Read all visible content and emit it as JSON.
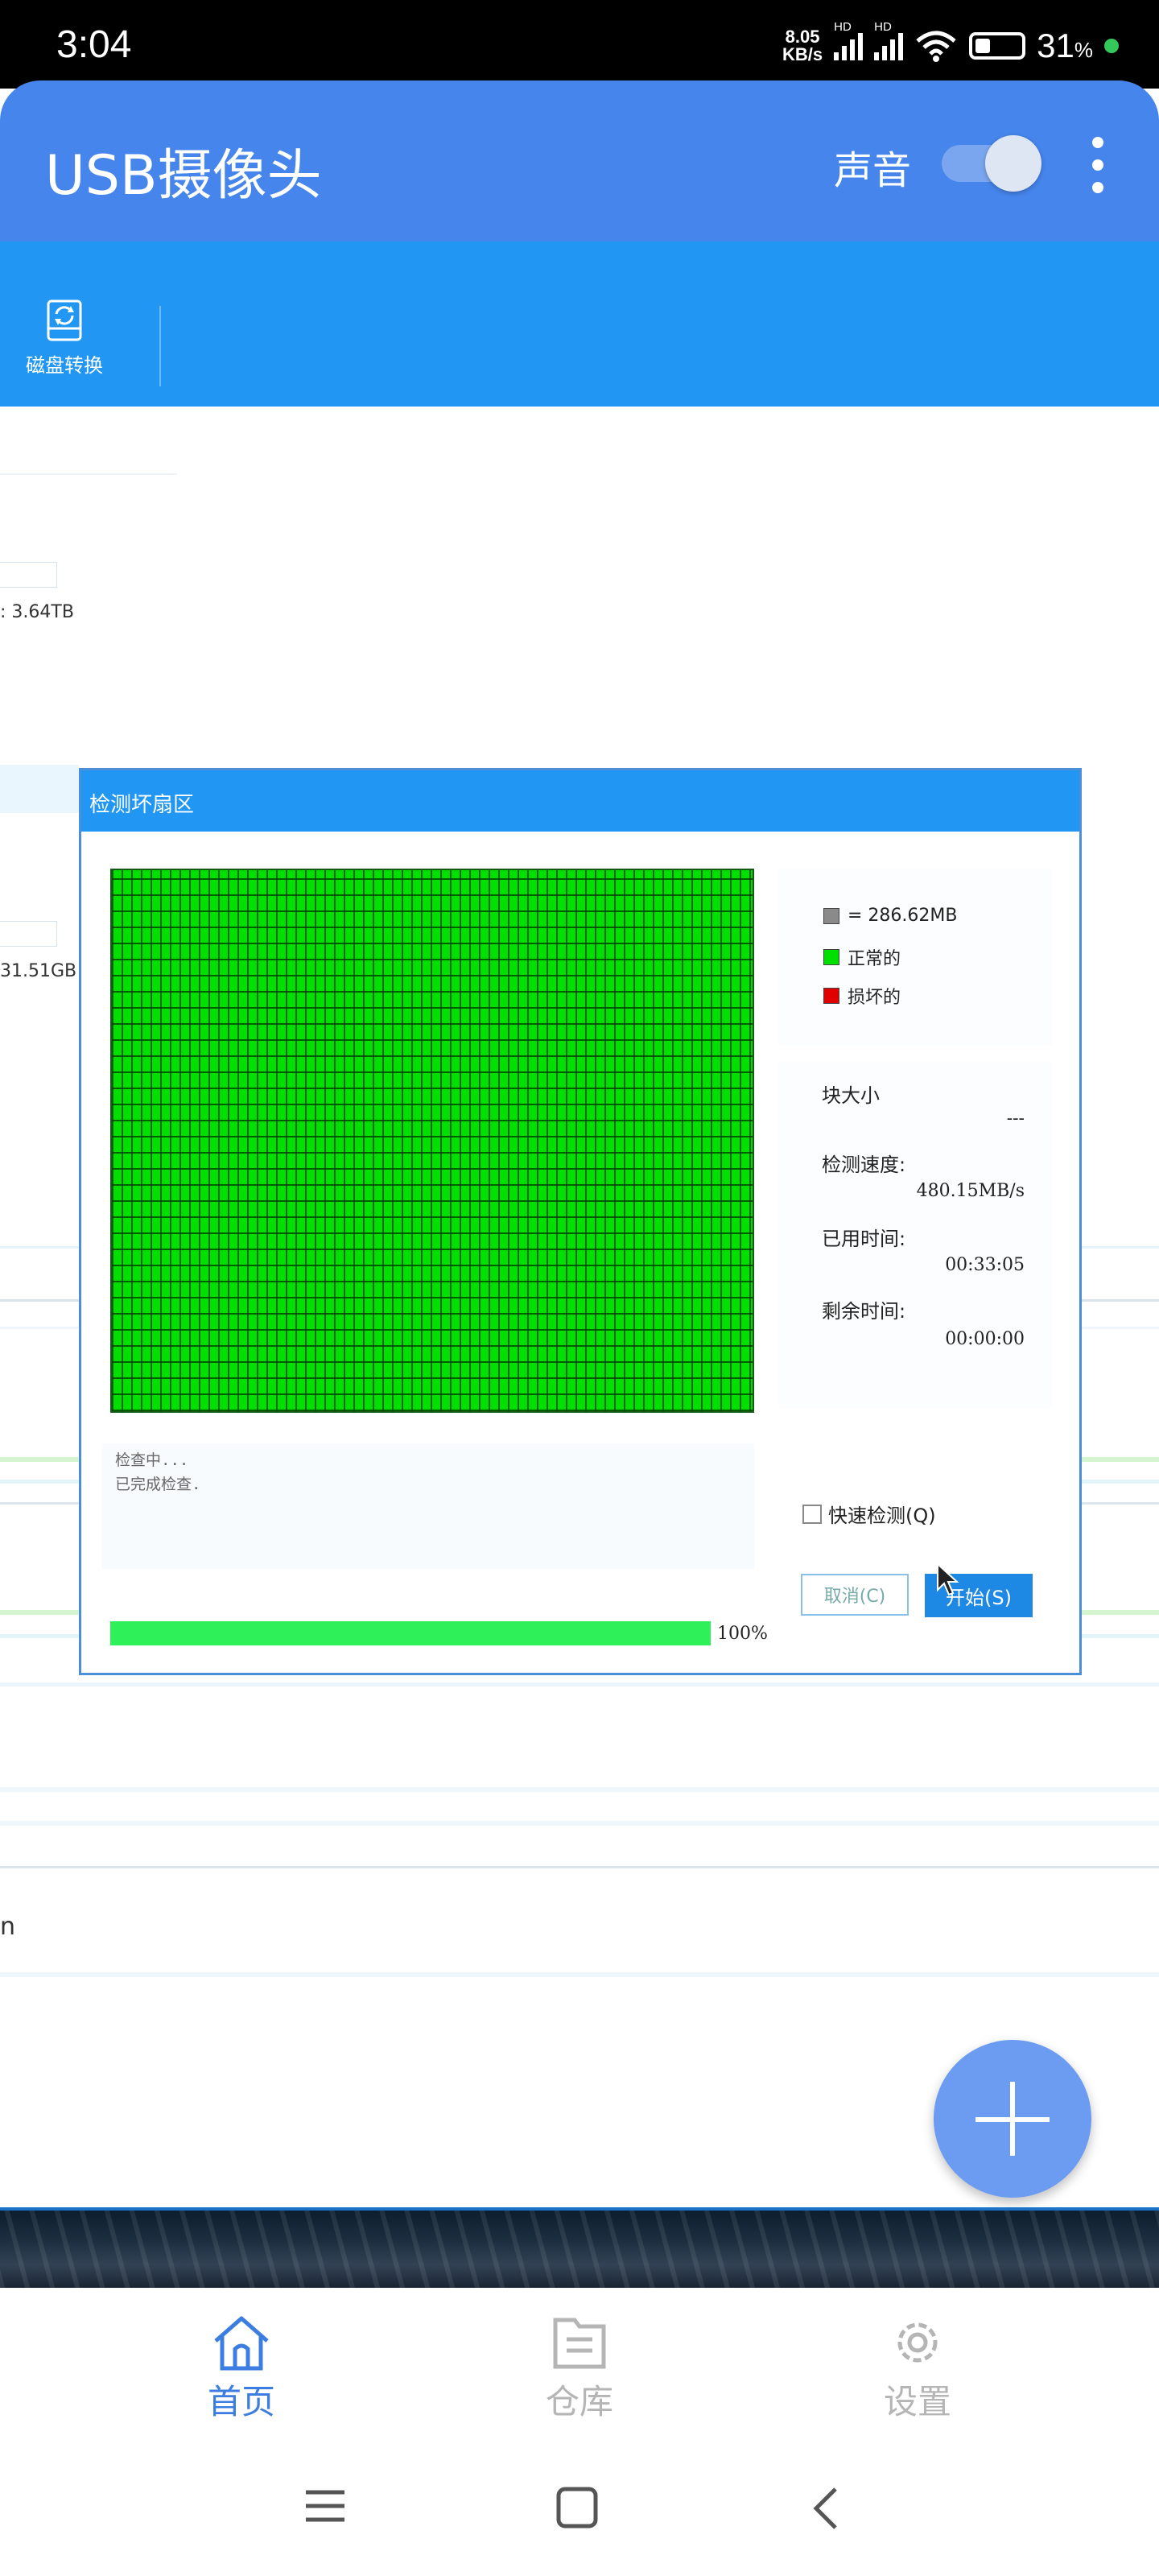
{
  "status_bar": {
    "time": "3:04",
    "net_speed_value": "8.05",
    "net_speed_unit": "KB/s",
    "network_label_1": "HD",
    "network_label_2": "HD",
    "battery_percent": "31",
    "battery_symbol": "%"
  },
  "app_bar": {
    "title": "USB摄像头",
    "sound_label": "声音",
    "sound_enabled": true
  },
  "toolbar": {
    "disk_convert_label": "磁盘转换"
  },
  "background": {
    "capacity_1": ": 3.64TB",
    "capacity_2": "31.51GB",
    "partial_text": "n"
  },
  "dialog": {
    "title": "检测坏扇区",
    "legend": [
      {
        "label": "= 286.62MB",
        "color": "#8a8a8a"
      },
      {
        "label": "正常的",
        "color": "#00e000"
      },
      {
        "label": "损坏的",
        "color": "#e00000"
      }
    ],
    "stats": {
      "block_size_label": "块大小",
      "block_size_value": "---",
      "speed_label": "检测速度:",
      "speed_value": "480.15MB/s",
      "elapsed_label": "已用时间:",
      "elapsed_value": "00:33:05",
      "remaining_label": "剩余时间:",
      "remaining_value": "00:00:00"
    },
    "log_lines": [
      "检查中...",
      "已完成检查."
    ],
    "quick_check_label": "快速检测(Q)",
    "quick_check_checked": false,
    "cancel_label": "取消(C)",
    "start_label": "开始(S)",
    "progress_percent": 100,
    "progress_label": "100%"
  },
  "bottom_nav": {
    "items": [
      {
        "label": "首页",
        "icon": "home-icon",
        "active": true
      },
      {
        "label": "仓库",
        "icon": "warehouse-icon",
        "active": false
      },
      {
        "label": "设置",
        "icon": "settings-gear-icon",
        "active": false
      }
    ]
  },
  "colors": {
    "app_bar": "#4685ec",
    "toolbar": "#2196f3",
    "nav_active": "#3b7de0",
    "nav_inactive": "#b5b5b5",
    "grid_ok": "#00e000"
  }
}
